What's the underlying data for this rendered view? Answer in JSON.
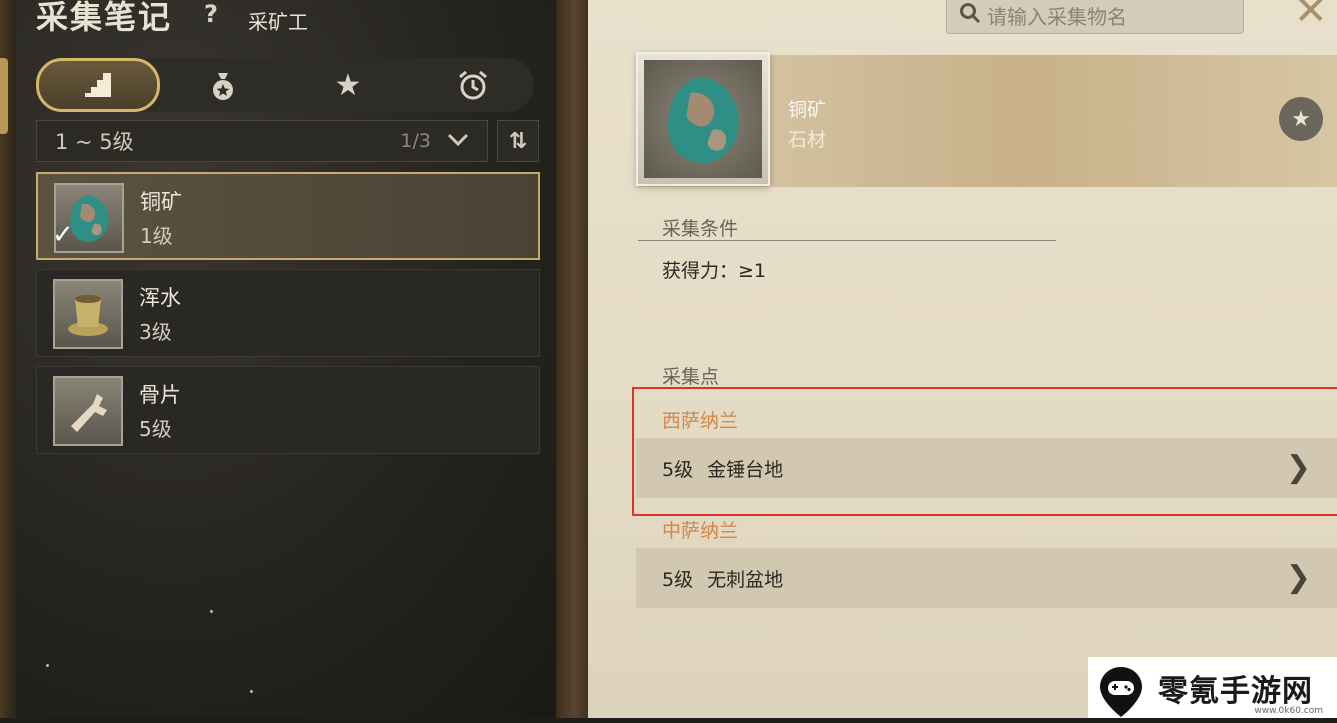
{
  "left_panel": {
    "title": "采集笔记",
    "help": "?",
    "subtitle": "采矿工",
    "tabs": [
      {
        "icon": "stairs-icon",
        "glyph": "▟"
      },
      {
        "icon": "bag-icon",
        "glyph": "♁"
      },
      {
        "icon": "star-icon",
        "glyph": "★"
      },
      {
        "icon": "alarm-clock-icon",
        "glyph": "⏰"
      }
    ],
    "filter": {
      "range": "1 ~ 5级",
      "page": "1/3",
      "chevron": "⌄"
    },
    "sort_glyph": "⇅",
    "items": [
      {
        "name": "铜矿",
        "level": "1级",
        "icon": "copper-ore-icon",
        "selected": true
      },
      {
        "name": "浑水",
        "level": "3级",
        "icon": "muddy-water-icon",
        "selected": false
      },
      {
        "name": "骨片",
        "level": "5级",
        "icon": "bone-fragment-icon",
        "selected": false
      }
    ]
  },
  "right_panel": {
    "search_placeholder": "请输入采集物名",
    "close_glyph": "✕",
    "item": {
      "name": "铜矿",
      "type": "石材"
    },
    "fav_glyph": "★",
    "conditions": {
      "title": "采集条件",
      "text": "获得力：≥1"
    },
    "points": {
      "title": "采集点",
      "regions": [
        {
          "name": "西萨纳兰",
          "level": "5级",
          "place": "金锤台地"
        },
        {
          "name": "中萨纳兰",
          "level": "5级",
          "place": "无刺盆地"
        }
      ]
    },
    "arrow_glyph": "❯"
  },
  "watermark": {
    "text": "零氪手游网",
    "url": "www.0k60.com"
  },
  "colors": {
    "accent_gold": "#c9ab68",
    "region_orange": "#d0884a",
    "highlight_red": "#e0312b"
  }
}
